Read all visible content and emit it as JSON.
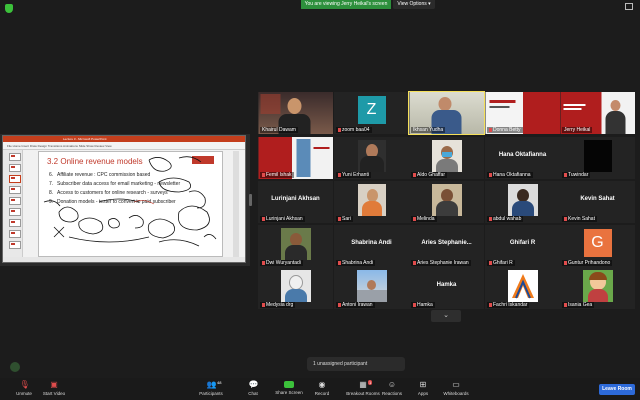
{
  "top_bar": {
    "banner": "You are viewing Jerry Heikal's screen",
    "view_options": "View Options"
  },
  "shared_screen": {
    "window_title": "Lecture 3 - Microsoft PowerPoint",
    "ribbon": "File   Home   Insert   Draw   Design   Transitions   Animations   Slide Show   Review   View",
    "slide": {
      "title": "3.2 Online revenue models",
      "items": [
        {
          "num": "6.",
          "text": "Affiliate revenue : CPC commission based"
        },
        {
          "num": "7.",
          "text": "Subscriber data access for email marketing - newsletter"
        },
        {
          "num": "8.",
          "text": "Access to customers for online research - surveys"
        },
        {
          "num": "9.",
          "text": "Donation models - tester to convert to paid subscriber"
        }
      ]
    }
  },
  "participants": [
    {
      "name": "Khairul Dawam",
      "display": "video",
      "muted": false
    },
    {
      "name": "zoom baa04",
      "display": "avatar",
      "avatar_letter": "Z",
      "avatar_color": "#1e9aa8",
      "muted": true
    },
    {
      "name": "Ikhsan Yudha",
      "display": "video",
      "muted": false,
      "speaking": true
    },
    {
      "name": "Donna Betty",
      "display": "slide",
      "muted": true
    },
    {
      "name": "Jerry Heikal",
      "display": "slide",
      "muted": false
    },
    {
      "name": "Femil Ishak",
      "display": "slide",
      "muted": true
    },
    {
      "name": "Yuni Erhanti",
      "display": "video",
      "muted": true
    },
    {
      "name": "Aldo Ghaffar",
      "display": "video",
      "muted": true
    },
    {
      "name": "Hana Oktafianna",
      "display": "name",
      "muted": true
    },
    {
      "name": "Tuwindar",
      "display": "black",
      "muted": true
    },
    {
      "name": "Lurinjani Akhsan",
      "display": "name",
      "muted": true
    },
    {
      "name": "Sari",
      "display": "video",
      "muted": true
    },
    {
      "name": "Melinda",
      "display": "video",
      "muted": true
    },
    {
      "name": "abdul wahab",
      "display": "video",
      "muted": true
    },
    {
      "name": "Kevin Sahat",
      "display": "name",
      "muted": true
    },
    {
      "name": "Dwi Wuryantadi",
      "display": "video",
      "muted": true
    },
    {
      "name": "Shabrina Andi",
      "display": "name",
      "muted": true
    },
    {
      "name": "Aries Stephanie Irawan",
      "bigname": "Aries Stephanie...",
      "display": "name",
      "muted": true
    },
    {
      "name": "Ghifari R",
      "display": "name",
      "muted": true
    },
    {
      "name": "Guntur Prihandono",
      "display": "avatar",
      "avatar_letter": "G",
      "avatar_color": "#e9733f",
      "muted": true
    },
    {
      "name": "Medysia drg",
      "display": "video",
      "muted": true
    },
    {
      "name": "Antoni Irawan",
      "display": "video",
      "muted": true
    },
    {
      "name": "Hamka",
      "display": "name",
      "muted": true
    },
    {
      "name": "Fachri Iskandar",
      "display": "logo",
      "muted": true
    },
    {
      "name": "Isania Gea",
      "display": "cartoon",
      "muted": true
    }
  ],
  "breakout_notice": "1 unassigned participant",
  "toolbar": {
    "unmute": "Unmute",
    "start_video": "Start Video",
    "participants": "Participants",
    "participants_count": "48",
    "chat": "Chat",
    "share_screen": "Share Screen",
    "record": "Record",
    "breakout_rooms": "Breakout Rooms",
    "breakout_badge": "1",
    "reactions": "Reactions",
    "apps": "Apps",
    "whiteboards": "Whiteboards",
    "leave": "Leave Room"
  },
  "colors": {
    "speaking_outline": "#f5e05a",
    "banner_green": "#2d8f3c",
    "leave_blue": "#2d6ad9",
    "slide_red": "#c0392b"
  }
}
